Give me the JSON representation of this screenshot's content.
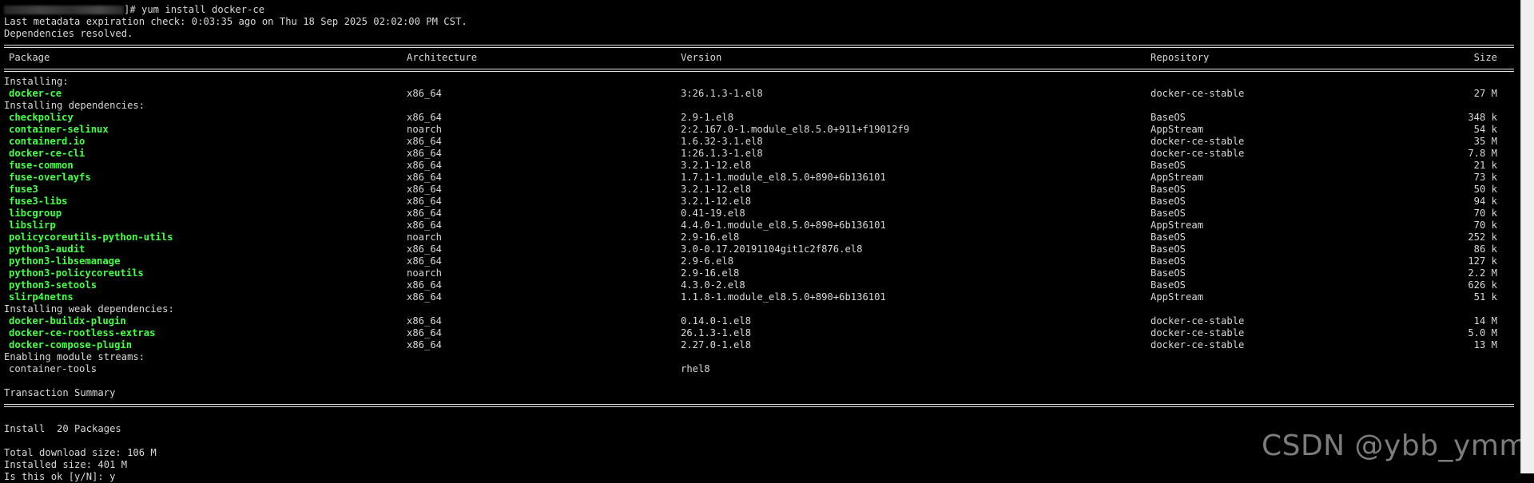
{
  "prompt": {
    "command": "]# yum install docker-ce"
  },
  "header_lines": [
    "Last metadata expiration check: 0:03:35 ago on Thu 18 Sep 2025 02:02:00 PM CST.",
    "Dependencies resolved."
  ],
  "columns": {
    "package": "Package",
    "architecture": "Architecture",
    "version": "Version",
    "repository": "Repository",
    "size": "Size"
  },
  "sections": [
    {
      "title": "Installing:",
      "rows": [
        {
          "name": "docker-ce",
          "arch": "x86_64",
          "version": "3:26.1.3-1.el8",
          "repo": "docker-ce-stable",
          "size": "27 M"
        }
      ]
    },
    {
      "title": "Installing dependencies:",
      "rows": [
        {
          "name": "checkpolicy",
          "arch": "x86_64",
          "version": "2.9-1.el8",
          "repo": "BaseOS",
          "size": "348 k"
        },
        {
          "name": "container-selinux",
          "arch": "noarch",
          "version": "2:2.167.0-1.module_el8.5.0+911+f19012f9",
          "repo": "AppStream",
          "size": "54 k"
        },
        {
          "name": "containerd.io",
          "arch": "x86_64",
          "version": "1.6.32-3.1.el8",
          "repo": "docker-ce-stable",
          "size": "35 M"
        },
        {
          "name": "docker-ce-cli",
          "arch": "x86_64",
          "version": "1:26.1.3-1.el8",
          "repo": "docker-ce-stable",
          "size": "7.8 M"
        },
        {
          "name": "fuse-common",
          "arch": "x86_64",
          "version": "3.2.1-12.el8",
          "repo": "BaseOS",
          "size": "21 k"
        },
        {
          "name": "fuse-overlayfs",
          "arch": "x86_64",
          "version": "1.7.1-1.module_el8.5.0+890+6b136101",
          "repo": "AppStream",
          "size": "73 k"
        },
        {
          "name": "fuse3",
          "arch": "x86_64",
          "version": "3.2.1-12.el8",
          "repo": "BaseOS",
          "size": "50 k"
        },
        {
          "name": "fuse3-libs",
          "arch": "x86_64",
          "version": "3.2.1-12.el8",
          "repo": "BaseOS",
          "size": "94 k"
        },
        {
          "name": "libcgroup",
          "arch": "x86_64",
          "version": "0.41-19.el8",
          "repo": "BaseOS",
          "size": "70 k"
        },
        {
          "name": "libslirp",
          "arch": "x86_64",
          "version": "4.4.0-1.module_el8.5.0+890+6b136101",
          "repo": "AppStream",
          "size": "70 k"
        },
        {
          "name": "policycoreutils-python-utils",
          "arch": "noarch",
          "version": "2.9-16.el8",
          "repo": "BaseOS",
          "size": "252 k"
        },
        {
          "name": "python3-audit",
          "arch": "x86_64",
          "version": "3.0-0.17.20191104git1c2f876.el8",
          "repo": "BaseOS",
          "size": "86 k"
        },
        {
          "name": "python3-libsemanage",
          "arch": "x86_64",
          "version": "2.9-6.el8",
          "repo": "BaseOS",
          "size": "127 k"
        },
        {
          "name": "python3-policycoreutils",
          "arch": "noarch",
          "version": "2.9-16.el8",
          "repo": "BaseOS",
          "size": "2.2 M"
        },
        {
          "name": "python3-setools",
          "arch": "x86_64",
          "version": "4.3.0-2.el8",
          "repo": "BaseOS",
          "size": "626 k"
        },
        {
          "name": "slirp4netns",
          "arch": "x86_64",
          "version": "1.1.8-1.module_el8.5.0+890+6b136101",
          "repo": "AppStream",
          "size": "51 k"
        }
      ]
    },
    {
      "title": "Installing weak dependencies:",
      "rows": [
        {
          "name": "docker-buildx-plugin",
          "arch": "x86_64",
          "version": "0.14.0-1.el8",
          "repo": "docker-ce-stable",
          "size": "14 M"
        },
        {
          "name": "docker-ce-rootless-extras",
          "arch": "x86_64",
          "version": "26.1.3-1.el8",
          "repo": "docker-ce-stable",
          "size": "5.0 M"
        },
        {
          "name": "docker-compose-plugin",
          "arch": "x86_64",
          "version": "2.27.0-1.el8",
          "repo": "docker-ce-stable",
          "size": "13 M"
        }
      ]
    }
  ],
  "module_streams": {
    "title": "Enabling module streams:",
    "name": "container-tools",
    "stream": "rhel8"
  },
  "summary": {
    "title": "Transaction Summary",
    "install_line": "Install  20 Packages",
    "download_size": "Total download size: 106 M",
    "installed_size": "Installed size: 401 M",
    "confirm": "Is this ok [y/N]: y"
  },
  "watermark": "CSDN @ybb_ymm"
}
